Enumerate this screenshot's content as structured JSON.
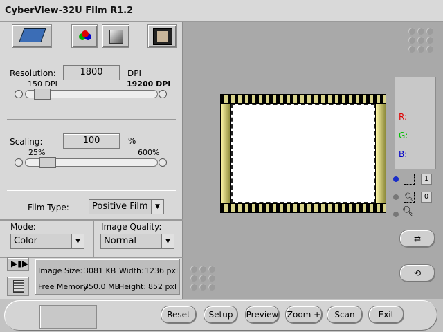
{
  "window": {
    "title": "CyberView-32U Film R1.2"
  },
  "resolution": {
    "label": "Resolution:",
    "value": "1800",
    "unit": "DPI",
    "min": "150 DPI",
    "max": "19200 DPI"
  },
  "scaling": {
    "label": "Scaling:",
    "value": "100",
    "unit": "%",
    "min": "25%",
    "max": "600%"
  },
  "film_type": {
    "label": "Film Type:",
    "selected": "Positive Film"
  },
  "mode": {
    "label": "Mode:",
    "selected": "Color"
  },
  "image_quality": {
    "label": "Image Quality:",
    "selected": "Normal"
  },
  "info": {
    "image_size_label": "Image Size:",
    "image_size_value": "3081 KB",
    "width_label": "Width:",
    "width_value": "1236 pxl",
    "free_memory_label": "Free Memory",
    "free_memory_value": "350.0 MB",
    "height_label": "Height:",
    "height_value": "852 pxl"
  },
  "color_readout": {
    "r": "R:",
    "g": "G:",
    "b": "B:"
  },
  "tool_counts": {
    "select": "1",
    "zoom": "0"
  },
  "buttons": {
    "reset": "Reset",
    "setup": "Setup",
    "preview": "Preview",
    "zoom": "Zoom +",
    "scan": "Scan",
    "exit": "Exit"
  },
  "colors": {
    "film_frame": "#d8d38a",
    "film_black": "#000000",
    "r_color": "#e00000",
    "g_color": "#00c000",
    "b_color": "#0000c8"
  }
}
